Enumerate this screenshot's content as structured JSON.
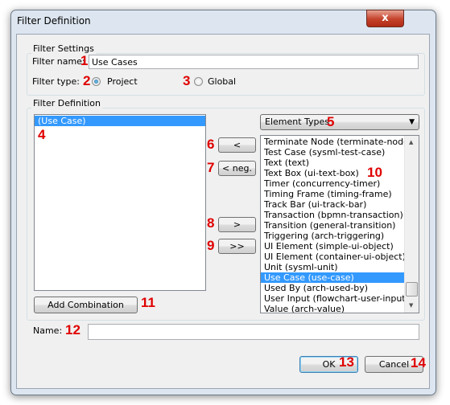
{
  "window": {
    "title": "Filter Definition",
    "close_label": "x"
  },
  "filter_settings": {
    "group_label": "Filter Settings",
    "name_label": "Filter name:",
    "name_value": "Use Cases",
    "type_label": "Filter type:",
    "options": [
      {
        "label": "Project",
        "selected": true
      },
      {
        "label": "Global",
        "selected": false
      }
    ]
  },
  "filter_definition": {
    "group_label": "Filter Definition",
    "selected_items": [
      "(Use Case)"
    ],
    "buttons": {
      "add": "<",
      "add_neg": "< neg.",
      "remove": ">",
      "remove_all": ">>",
      "add_combination": "Add Combination"
    },
    "dropdown": {
      "value": "Element Types"
    },
    "available_items": [
      "Terminate Node (terminate-node)",
      "Test Case (sysml-test-case)",
      "Text (text)",
      "Text Box (ui-text-box)",
      "Timer (concurrency-timer)",
      "Timing Frame (timing-frame)",
      "Track Bar (ui-track-bar)",
      "Transaction (bpmn-transaction)",
      "Transition (general-transition)",
      "Triggering (arch-triggering)",
      "UI Element (simple-ui-object)",
      "UI Element (container-ui-object)",
      "Unit (sysml-unit)",
      "Use Case (use-case)",
      "Used By (arch-used-by)",
      "User Input (flowchart-user-input)",
      "Value (arch-value)"
    ],
    "available_selected": "Use Case (use-case)"
  },
  "name_field": {
    "label": "Name:",
    "value": ""
  },
  "footer": {
    "ok": "OK",
    "cancel": "Cancel"
  },
  "callouts": [
    "1",
    "2",
    "3",
    "4",
    "5",
    "6",
    "7",
    "8",
    "9",
    "10",
    "11",
    "12",
    "13",
    "14"
  ]
}
